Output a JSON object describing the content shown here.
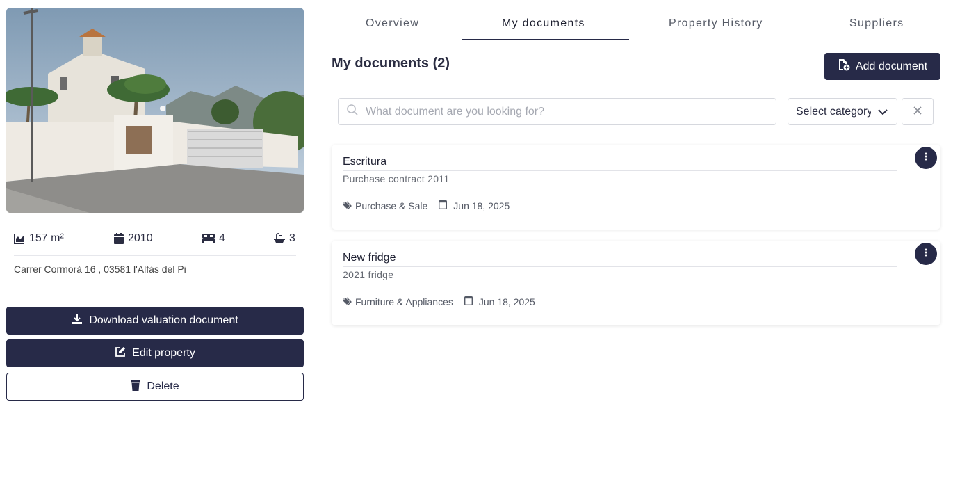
{
  "property": {
    "photo_alt": "",
    "area": "157 m²",
    "year": "2010",
    "bedrooms": "4",
    "bathrooms": "3",
    "address": "Carrer Cormorà 16 , 03581 l'Alfàs del Pi"
  },
  "actions": {
    "download_label": "Download valuation document",
    "edit_label": "Edit property",
    "delete_label": "Delete"
  },
  "tabs": [
    {
      "label": "Overview",
      "active": false
    },
    {
      "label": "My documents",
      "active": true
    },
    {
      "label": "Property History",
      "active": false
    },
    {
      "label": "Suppliers",
      "active": false
    }
  ],
  "documents": {
    "title": "My documents (2)",
    "add_label": "Add document",
    "search_placeholder": "What document are you looking for?",
    "category_select": "Select category",
    "items": [
      {
        "title": "Escritura",
        "subtitle": "Purchase contract 2011",
        "category": "Purchase & Sale",
        "date": "Jun 18, 2025"
      },
      {
        "title": "New fridge",
        "subtitle": "2021 fridge",
        "category": "Furniture & Appliances",
        "date": "Jun 18, 2025"
      }
    ]
  },
  "colors": {
    "primary": "#272a48",
    "text": "#2b2d42",
    "muted": "#666a73",
    "border": "#d6d8de"
  }
}
